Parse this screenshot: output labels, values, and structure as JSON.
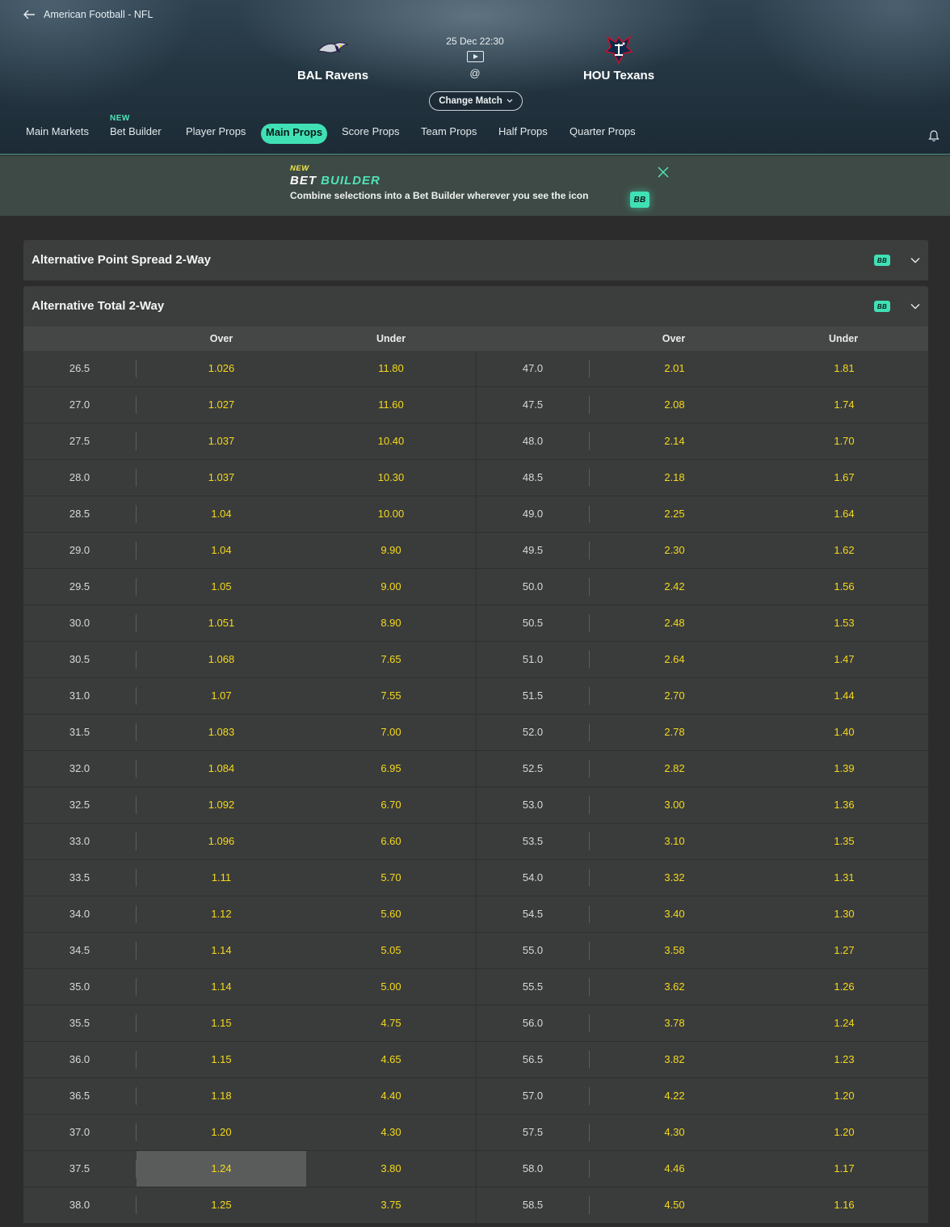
{
  "breadcrumb": {
    "label": "American Football - NFL"
  },
  "match": {
    "home_team": "BAL Ravens",
    "away_team": "HOU Texans",
    "datetime": "25 Dec 22:30",
    "separator": "@",
    "change_match_label": "Change Match"
  },
  "tabs": [
    {
      "label": "Main Markets"
    },
    {
      "label": "Bet Builder",
      "badge": "NEW"
    },
    {
      "label": "Player Props"
    },
    {
      "label": "Main Props",
      "active": true
    },
    {
      "label": "Score Props"
    },
    {
      "label": "Team Props"
    },
    {
      "label": "Half Props"
    },
    {
      "label": "Quarter Props"
    }
  ],
  "promo": {
    "new_tag": "NEW",
    "title_part1": "BET ",
    "title_part2": "BUILDER",
    "description": "Combine selections into a Bet Builder wherever you see the icon",
    "bb_chip": "BB"
  },
  "markets": [
    {
      "title": "Alternative Point Spread 2-Way",
      "bb_chip": "BB",
      "expanded": false
    },
    {
      "title": "Alternative Total 2-Way",
      "bb_chip": "BB",
      "expanded": true
    }
  ],
  "table": {
    "headers": {
      "left_over": "Over",
      "left_under": "Under",
      "right_over": "Over",
      "right_under": "Under"
    },
    "rows": [
      {
        "l_line": "26.5",
        "l_over": "1.026",
        "l_under": "11.80",
        "r_line": "47.0",
        "r_over": "2.01",
        "r_under": "1.81"
      },
      {
        "l_line": "27.0",
        "l_over": "1.027",
        "l_under": "11.60",
        "r_line": "47.5",
        "r_over": "2.08",
        "r_under": "1.74"
      },
      {
        "l_line": "27.5",
        "l_over": "1.037",
        "l_under": "10.40",
        "r_line": "48.0",
        "r_over": "2.14",
        "r_under": "1.70"
      },
      {
        "l_line": "28.0",
        "l_over": "1.037",
        "l_under": "10.30",
        "r_line": "48.5",
        "r_over": "2.18",
        "r_under": "1.67"
      },
      {
        "l_line": "28.5",
        "l_over": "1.04",
        "l_under": "10.00",
        "r_line": "49.0",
        "r_over": "2.25",
        "r_under": "1.64"
      },
      {
        "l_line": "29.0",
        "l_over": "1.04",
        "l_under": "9.90",
        "r_line": "49.5",
        "r_over": "2.30",
        "r_under": "1.62"
      },
      {
        "l_line": "29.5",
        "l_over": "1.05",
        "l_under": "9.00",
        "r_line": "50.0",
        "r_over": "2.42",
        "r_under": "1.56"
      },
      {
        "l_line": "30.0",
        "l_over": "1.051",
        "l_under": "8.90",
        "r_line": "50.5",
        "r_over": "2.48",
        "r_under": "1.53"
      },
      {
        "l_line": "30.5",
        "l_over": "1.068",
        "l_under": "7.65",
        "r_line": "51.0",
        "r_over": "2.64",
        "r_under": "1.47"
      },
      {
        "l_line": "31.0",
        "l_over": "1.07",
        "l_under": "7.55",
        "r_line": "51.5",
        "r_over": "2.70",
        "r_under": "1.44"
      },
      {
        "l_line": "31.5",
        "l_over": "1.083",
        "l_under": "7.00",
        "r_line": "52.0",
        "r_over": "2.78",
        "r_under": "1.40"
      },
      {
        "l_line": "32.0",
        "l_over": "1.084",
        "l_under": "6.95",
        "r_line": "52.5",
        "r_over": "2.82",
        "r_under": "1.39"
      },
      {
        "l_line": "32.5",
        "l_over": "1.092",
        "l_under": "6.70",
        "r_line": "53.0",
        "r_over": "3.00",
        "r_under": "1.36"
      },
      {
        "l_line": "33.0",
        "l_over": "1.096",
        "l_under": "6.60",
        "r_line": "53.5",
        "r_over": "3.10",
        "r_under": "1.35"
      },
      {
        "l_line": "33.5",
        "l_over": "1.11",
        "l_under": "5.70",
        "r_line": "54.0",
        "r_over": "3.32",
        "r_under": "1.31"
      },
      {
        "l_line": "34.0",
        "l_over": "1.12",
        "l_under": "5.60",
        "r_line": "54.5",
        "r_over": "3.40",
        "r_under": "1.30"
      },
      {
        "l_line": "34.5",
        "l_over": "1.14",
        "l_under": "5.05",
        "r_line": "55.0",
        "r_over": "3.58",
        "r_under": "1.27"
      },
      {
        "l_line": "35.0",
        "l_over": "1.14",
        "l_under": "5.00",
        "r_line": "55.5",
        "r_over": "3.62",
        "r_under": "1.26"
      },
      {
        "l_line": "35.5",
        "l_over": "1.15",
        "l_under": "4.75",
        "r_line": "56.0",
        "r_over": "3.78",
        "r_under": "1.24"
      },
      {
        "l_line": "36.0",
        "l_over": "1.15",
        "l_under": "4.65",
        "r_line": "56.5",
        "r_over": "3.82",
        "r_under": "1.23"
      },
      {
        "l_line": "36.5",
        "l_over": "1.18",
        "l_under": "4.40",
        "r_line": "57.0",
        "r_over": "4.22",
        "r_under": "1.20"
      },
      {
        "l_line": "37.0",
        "l_over": "1.20",
        "l_under": "4.30",
        "r_line": "57.5",
        "r_over": "4.30",
        "r_under": "1.20"
      },
      {
        "l_line": "37.5",
        "l_over": "1.24",
        "l_under": "3.80",
        "r_line": "58.0",
        "r_over": "4.46",
        "r_under": "1.17",
        "hovered": "l_over"
      },
      {
        "l_line": "38.0",
        "l_over": "1.25",
        "l_under": "3.75",
        "r_line": "58.5",
        "r_over": "4.50",
        "r_under": "1.16"
      }
    ]
  },
  "colors": {
    "accent": "#40e0b5",
    "odds": "#f5d91c",
    "background": "#2b2c2b",
    "row": "#3a3c3b"
  },
  "icons": {
    "back": "arrow-left-icon",
    "play": "play-icon",
    "chevron": "chevron-down-icon",
    "bell": "bell-icon",
    "close": "close-icon"
  }
}
